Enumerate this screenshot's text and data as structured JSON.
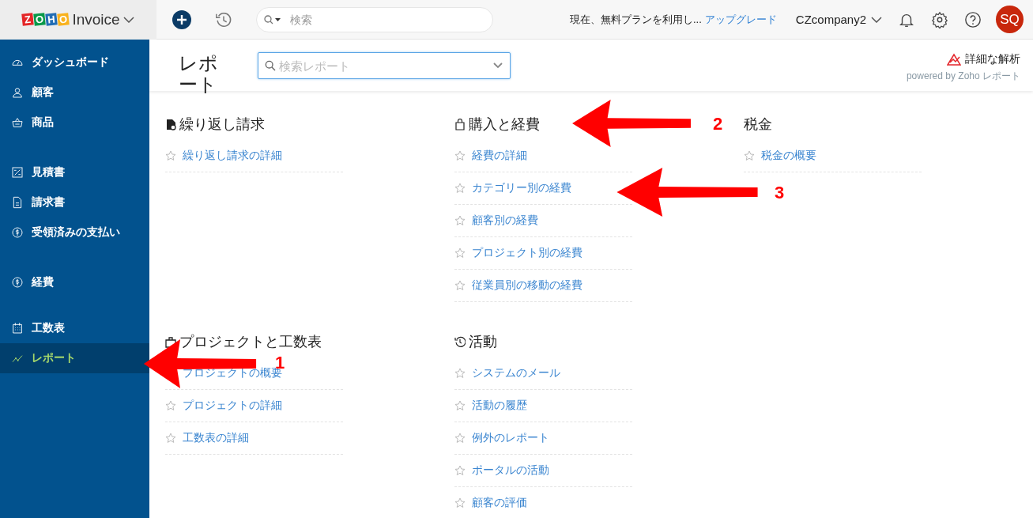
{
  "brand": {
    "letters": [
      {
        "char": "Z",
        "color": "#e42527"
      },
      {
        "char": "O",
        "color": "#089949"
      },
      {
        "char": "H",
        "color": "#226db4"
      },
      {
        "char": "O",
        "color": "#f9b21d"
      }
    ],
    "product": "Invoice"
  },
  "topbar": {
    "search": {
      "placeholder": "検索"
    },
    "plan_notice": "現在、無料プランを利用し...",
    "upgrade_link": "アップグレード",
    "organization": "CZcompany2",
    "avatar": "SQ"
  },
  "sidebar": {
    "groups": [
      [
        {
          "label": "ダッシュボード",
          "selected": false
        },
        {
          "label": "顧客",
          "selected": false
        },
        {
          "label": "商品",
          "selected": false
        }
      ],
      [
        {
          "label": "見積書",
          "selected": false
        },
        {
          "label": "請求書",
          "selected": false
        },
        {
          "label": "受領済みの支払い",
          "selected": false
        }
      ],
      [
        {
          "label": "経費",
          "selected": false
        }
      ],
      [
        {
          "label": "工数表",
          "selected": false
        },
        {
          "label": "レポート",
          "selected": true
        }
      ]
    ]
  },
  "page": {
    "title": "レポート",
    "search": {
      "placeholder": "検索レポート"
    },
    "analytics_link": "詳細な解析",
    "powered_by": "powered by Zoho レポート"
  },
  "sections": [
    {
      "title": "繰り返し請求",
      "reports": [
        {
          "label": "繰り返し請求の詳細",
          "starred": false
        }
      ]
    },
    {
      "title": "購入と経費",
      "reports": [
        {
          "label": "経費の詳細",
          "starred": false
        },
        {
          "label": "カテゴリー別の経費",
          "starred": false
        },
        {
          "label": "顧客別の経費",
          "starred": false
        },
        {
          "label": "プロジェクト別の経費",
          "starred": false
        },
        {
          "label": "従業員別の移動の経費",
          "starred": false
        }
      ]
    },
    {
      "title": "税金",
      "reports": [
        {
          "label": "税金の概要",
          "starred": false
        }
      ]
    },
    {
      "title": "プロジェクトと工数表",
      "reports": [
        {
          "label": "プロジェクトの概要"
        },
        {
          "label": "プロジェクトの詳細",
          "starred": false
        },
        {
          "label": "工数表の詳細",
          "starred": false
        }
      ]
    },
    {
      "title": "活動",
      "reports": [
        {
          "label": "システムのメール",
          "starred": false
        },
        {
          "label": "活動の履歴",
          "starred": false
        },
        {
          "label": "例外のレポート",
          "starred": false
        },
        {
          "label": "ポータルの活動",
          "starred": false
        },
        {
          "label": "顧客の評価",
          "starred": false
        }
      ]
    }
  ],
  "annotations": [
    {
      "label": "1"
    },
    {
      "label": "2"
    },
    {
      "label": "3"
    }
  ]
}
